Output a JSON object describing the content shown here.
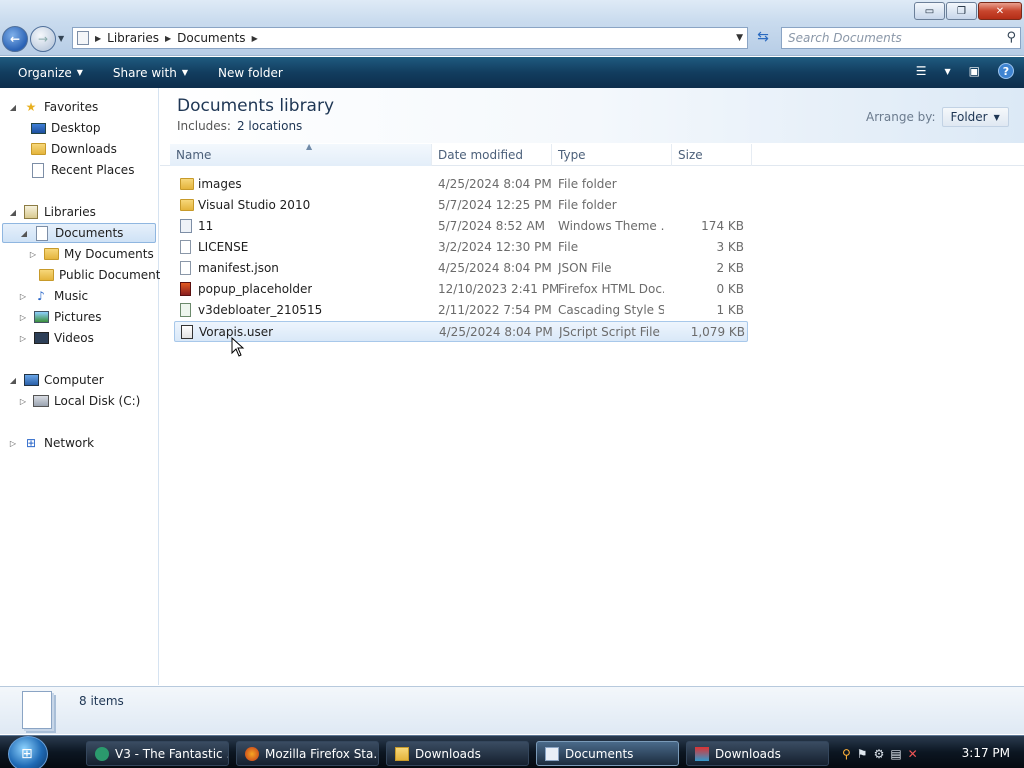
{
  "window": {
    "controls": {
      "minimize": "▭",
      "maximize": "❐",
      "close": "✕"
    }
  },
  "address": {
    "crumbs": [
      "Libraries",
      "Documents"
    ],
    "search_placeholder": "Search Documents"
  },
  "toolbar": {
    "organize": "Organize",
    "share_with": "Share with",
    "new_folder": "New folder"
  },
  "sidebar": {
    "favorites": {
      "label": "Favorites",
      "items": [
        "Desktop",
        "Downloads",
        "Recent Places"
      ]
    },
    "libraries": {
      "label": "Libraries",
      "documents": "Documents",
      "doc_children": [
        "My Documents",
        "Public Documents"
      ],
      "others": [
        "Music",
        "Pictures",
        "Videos"
      ]
    },
    "computer": {
      "label": "Computer",
      "items": [
        "Local Disk (C:)"
      ]
    },
    "network": {
      "label": "Network"
    }
  },
  "library": {
    "title": "Documents library",
    "includes_label": "Includes:",
    "includes_value": "2 locations",
    "arrange_label": "Arrange by:",
    "arrange_value": "Folder"
  },
  "columns": {
    "name": "Name",
    "date": "Date modified",
    "type": "Type",
    "size": "Size"
  },
  "files": [
    {
      "name": "images",
      "date": "4/25/2024 8:04 PM",
      "type": "File folder",
      "size": "",
      "icon": "folder-icon"
    },
    {
      "name": "Visual Studio 2010",
      "date": "5/7/2024 12:25 PM",
      "type": "File folder",
      "size": "",
      "icon": "folder-icon"
    },
    {
      "name": "11",
      "date": "5/7/2024 8:52 AM",
      "type": "Windows Theme ...",
      "size": "174 KB",
      "icon": "theme-file-icon"
    },
    {
      "name": "LICENSE",
      "date": "3/2/2024 12:30 PM",
      "type": "File",
      "size": "3 KB",
      "icon": "file-icon"
    },
    {
      "name": "manifest.json",
      "date": "4/25/2024 8:04 PM",
      "type": "JSON File",
      "size": "2 KB",
      "icon": "file-icon"
    },
    {
      "name": "popup_placeholder",
      "date": "12/10/2023 2:41 PM",
      "type": "Firefox HTML Doc...",
      "size": "0 KB",
      "icon": "firefox-html-icon"
    },
    {
      "name": "v3debloater_210515",
      "date": "2/11/2022 7:54 PM",
      "type": "Cascading Style S...",
      "size": "1 KB",
      "icon": "css-file-icon"
    },
    {
      "name": "Vorapis.user",
      "date": "4/25/2024 8:04 PM",
      "type": "JScript Script File",
      "size": "1,079 KB",
      "icon": "jscript-file-icon"
    }
  ],
  "status": {
    "item_count": "8 items"
  },
  "taskbar": {
    "tasks": [
      "V3 - The Fantastic ...",
      "Mozilla Firefox Sta...",
      "Downloads",
      "Documents",
      "Downloads"
    ],
    "clock": "3:17 PM"
  }
}
